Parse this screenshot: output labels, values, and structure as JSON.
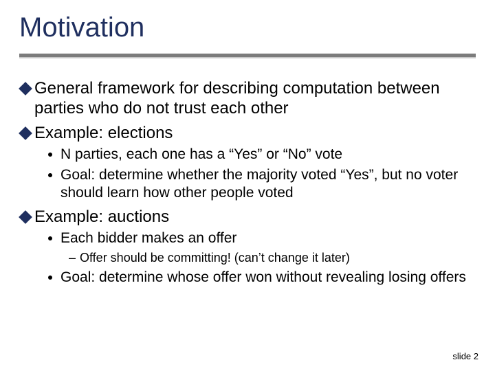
{
  "title": "Motivation",
  "bullets": {
    "b1": "General framework for describing computation between parties who do not trust each other",
    "b2": "Example: elections",
    "b2_sub1": "N parties, each one has a “Yes” or “No” vote",
    "b2_sub2": "Goal: determine whether the majority voted “Yes”, but no voter should learn how other people voted",
    "b3": "Example: auctions",
    "b3_sub1": "Each bidder makes an offer",
    "b3_sub1_sub1": "Offer should be committing! (can’t change it later)",
    "b3_sub2": "Goal: determine whose offer won without revealing losing offers"
  },
  "footer": "slide 2"
}
